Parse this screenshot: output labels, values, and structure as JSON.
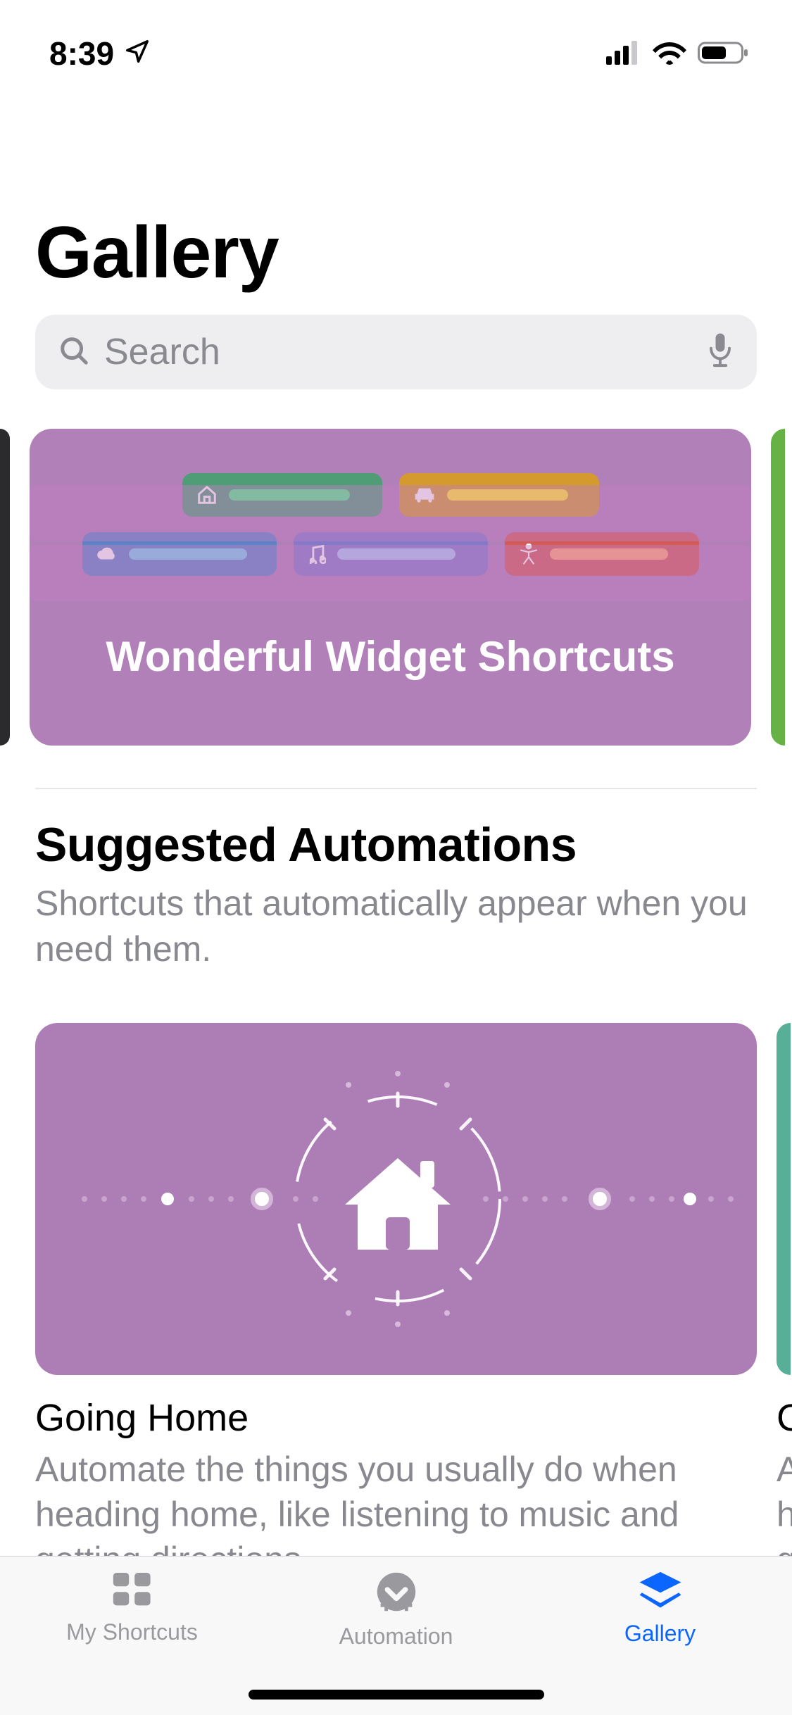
{
  "status": {
    "time": "8:39"
  },
  "header": {
    "title": "Gallery"
  },
  "search": {
    "placeholder": "Search"
  },
  "featured": {
    "card": {
      "title": "Wonderful Widget Shortcuts",
      "bg": "#b180b9"
    }
  },
  "sections": {
    "suggested": {
      "title": "Suggested Automations",
      "subtitle": "Shortcuts that automatically appear when you need them.",
      "items": [
        {
          "hero_bg": "#ad7eb5",
          "title": "Going Home",
          "desc": "Automate the things you usually do when heading home, like listening to music and getting directions."
        },
        {
          "title_peek": "G",
          "desc_peek": "A\nh\ng"
        }
      ]
    }
  },
  "tabs": {
    "my_shortcuts": "My Shortcuts",
    "automation": "Automation",
    "gallery": "Gallery"
  }
}
